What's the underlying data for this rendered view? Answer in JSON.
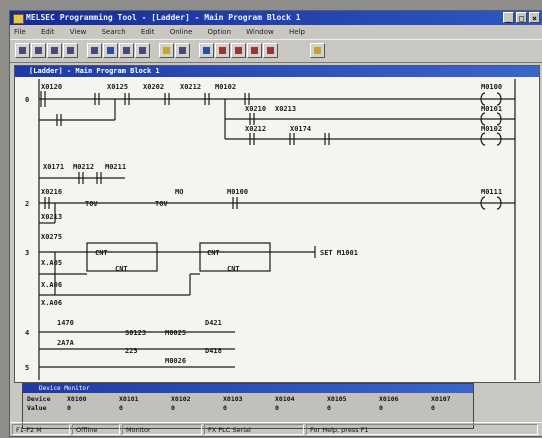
{
  "window": {
    "title": "MELSEC Programming Tool - [Ladder] - Main Program Block 1"
  },
  "menu": [
    "File",
    "Edit",
    "View",
    "Search",
    "Edit",
    "Online",
    "Option",
    "Window",
    "Help"
  ],
  "toolbar": {
    "button_count": 20
  },
  "child_window": {
    "title": "[Ladder] - Main Program Block 1"
  },
  "ladder": {
    "rungs": [
      {
        "step": "0",
        "contacts": [
          "X0120",
          "X0125",
          "X0202",
          "X0212",
          "M0102",
          "X0210",
          "X0213",
          "X0212",
          "X0174"
        ],
        "coils": [
          "M0100",
          "M0101",
          "M0102"
        ]
      },
      {
        "step": "",
        "contacts": [
          "X0171",
          "M0212",
          "M0211"
        ],
        "coils": []
      },
      {
        "step": "2",
        "contacts": [
          "X0216",
          "X0213",
          "M0100"
        ],
        "timer": [
          "TOV",
          "TOV"
        ],
        "fb": "MO",
        "coils": [
          "M0111"
        ]
      },
      {
        "step": "3",
        "contacts": [
          "X0275",
          "X.A05",
          "X.A06",
          "X.A06"
        ],
        "fb": [
          "CNT",
          "CNT",
          "CNT",
          "CNT"
        ],
        "coils": [
          "SET M1001"
        ]
      },
      {
        "step": "4",
        "values": [
          "1470",
          "S0123",
          "M0025",
          "D421"
        ]
      },
      {
        "step": "5",
        "values": [
          "2A7A",
          "225",
          "M0026",
          "D418"
        ]
      }
    ]
  },
  "monitor": {
    "title": "Device Monitor",
    "rows": [
      {
        "label": "Device",
        "cols": [
          "X0100",
          "X0101",
          "X0102",
          "X0103",
          "X0104",
          "X0105",
          "X0106",
          "X0107"
        ]
      },
      {
        "label": "Value",
        "cols": [
          "0",
          "0",
          "0",
          "0",
          "0",
          "0",
          "0",
          "0"
        ]
      }
    ]
  },
  "status": {
    "segments": [
      "F1-F2 M",
      "Offline",
      "Monitor",
      "FX PLC Serial",
      "For Help, press F1"
    ]
  }
}
